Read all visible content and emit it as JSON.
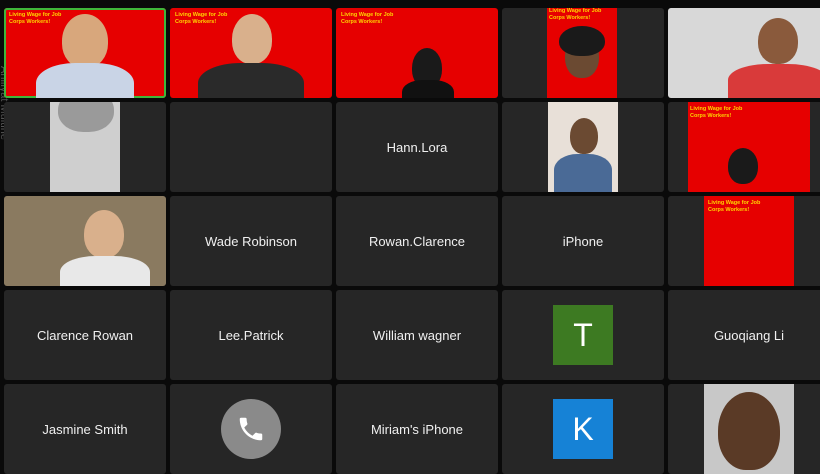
{
  "side_label": "Aniliyat Multine",
  "colors": {
    "tile_bg": "#262626",
    "active_border": "#3fb73a",
    "banner_red": "#e60000",
    "banner_text": "#ffd400"
  },
  "banner_text": "Living Wage for Job\nCorps Workers!",
  "participants": [
    {
      "type": "video",
      "label": "",
      "has_banner": true,
      "active": true
    },
    {
      "type": "video",
      "label": "",
      "has_banner": true
    },
    {
      "type": "video",
      "label": "",
      "has_banner": true
    },
    {
      "type": "video",
      "label": "",
      "has_banner": true
    },
    {
      "type": "video",
      "label": ""
    },
    {
      "type": "video",
      "label": ""
    },
    {
      "type": "name",
      "label": ""
    },
    {
      "type": "name",
      "label": "Hann.Lora"
    },
    {
      "type": "video",
      "label": ""
    },
    {
      "type": "video",
      "label": "",
      "has_banner": true
    },
    {
      "type": "video",
      "label": ""
    },
    {
      "type": "name",
      "label": "Wade Robinson"
    },
    {
      "type": "name",
      "label": "Rowan.Clarence"
    },
    {
      "type": "name",
      "label": "iPhone"
    },
    {
      "type": "video",
      "label": "",
      "has_banner": true
    },
    {
      "type": "name",
      "label": "Clarence Rowan"
    },
    {
      "type": "name",
      "label": "Lee.Patrick"
    },
    {
      "type": "name",
      "label": "William wagner"
    },
    {
      "type": "avatar",
      "label": "",
      "letter": "T",
      "color": "#3d7a22"
    },
    {
      "type": "name",
      "label": "Guoqiang Li"
    },
    {
      "type": "name",
      "label": "Jasmine Smith"
    },
    {
      "type": "phone",
      "label": "",
      "icon": "phone-icon"
    },
    {
      "type": "name",
      "label": "Miriam's iPhone"
    },
    {
      "type": "avatar",
      "label": "",
      "letter": "K",
      "color": "#1682d6"
    },
    {
      "type": "video",
      "label": ""
    }
  ]
}
